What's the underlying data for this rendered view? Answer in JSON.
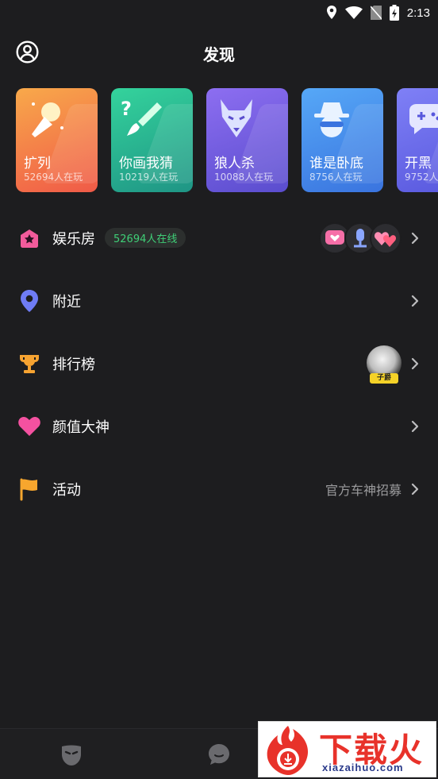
{
  "status_bar": {
    "time": "2:13"
  },
  "header": {
    "title": "发现"
  },
  "games": [
    {
      "name": "扩列",
      "count": "52694人在玩",
      "icon": "microphone-icon",
      "gradient": [
        "#f7a040",
        "#f05a48"
      ]
    },
    {
      "name": "你画我猜",
      "count": "10219人在玩",
      "icon": "paintbrush-icon",
      "gradient": [
        "#2fcf9a",
        "#1f9a86"
      ]
    },
    {
      "name": "狼人杀",
      "count": "10088人在玩",
      "icon": "wolf-icon",
      "gradient": [
        "#8a6df0",
        "#5b4fcf"
      ]
    },
    {
      "name": "谁是卧底",
      "count": "8756人在玩",
      "icon": "spy-icon",
      "gradient": [
        "#4fa0f5",
        "#3a76e0"
      ]
    },
    {
      "name": "开黑",
      "count": "9752人",
      "icon": "gamepad-icon",
      "gradient": [
        "#7a7cf5",
        "#5a5ae0"
      ]
    }
  ],
  "menu": {
    "entertainment": {
      "label": "娱乐房",
      "badge": "52694人在线",
      "icon": "house-star-icon"
    },
    "nearby": {
      "label": "附近",
      "icon": "location-pin-icon"
    },
    "ranking": {
      "label": "排行榜",
      "icon": "trophy-icon",
      "avatar_tag": "子爵"
    },
    "beauty": {
      "label": "颜值大神",
      "icon": "heart-icon"
    },
    "activity": {
      "label": "活动",
      "right_text": "官方车神招募",
      "icon": "flag-icon"
    }
  },
  "tabbar": {
    "tabs": [
      {
        "icon": "mask-icon"
      },
      {
        "icon": "chat-bubble-icon"
      }
    ]
  },
  "watermark": {
    "title": "下载火",
    "url": "xiazaihuo.com"
  },
  "colors": {
    "background": "#1d1d1f",
    "badge_text": "#3fcf77",
    "muted_text": "#9a9a9c"
  }
}
